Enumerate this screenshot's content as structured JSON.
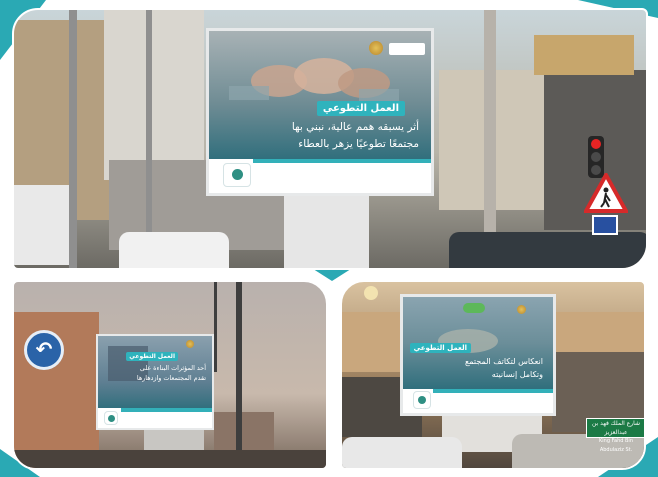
{
  "colors": {
    "accent_teal": "#2aa9b4",
    "billboard_title_bg": "#2fb3bd",
    "billboard_text": "#ffffff",
    "street_sign_green": "#1b7a45"
  },
  "billboard_top": {
    "title": "العمل التطوعي",
    "line1": "أثر يسبقه همم عالية، نبني بها",
    "line2": "مجتمعًا تطوعيًا يزهر بالعطاء"
  },
  "billboard_bottom_left": {
    "title": "العمل التطوعي",
    "line1": "أحد المؤثرات البناءة على",
    "line2": "تقدم المجتمعات وازدهارها"
  },
  "billboard_bottom_right": {
    "title": "العمل التطوعي",
    "line1": "انعكاس لتكاتف المجتمع",
    "line2": "وتكامل إنسانيته"
  },
  "street_sign": {
    "line1": "شارع الملك فهد بن عبدالعزيز",
    "line2": "King Fahd Bin Abdulaziz St."
  },
  "icons": [
    "traffic-light-icon",
    "pedestrian-crossing-icon",
    "u-turn-icon",
    "emblem-icon",
    "logo-icon"
  ]
}
